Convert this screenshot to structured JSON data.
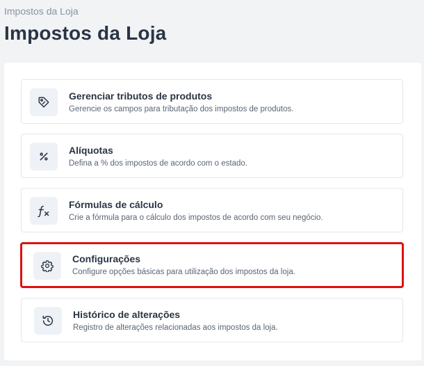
{
  "breadcrumb": "Impostos da Loja",
  "title": "Impostos da Loja",
  "cards": [
    {
      "title": "Gerenciar tributos de produtos",
      "description": "Gerencie os campos para tributação dos impostos de produtos.",
      "icon": "tag-icon"
    },
    {
      "title": "Alíquotas",
      "description": "Defina a % dos impostos de acordo com o estado.",
      "icon": "percent-icon"
    },
    {
      "title": "Fórmulas de cálculo",
      "description": "Crie a fórmula para o cálculo dos impostos de acordo com seu negócio.",
      "icon": "function-icon"
    },
    {
      "title": "Configurações",
      "description": "Configure opções básicas para utilização dos impostos da loja.",
      "icon": "gear-icon",
      "highlighted": true
    },
    {
      "title": "Histórico de alterações",
      "description": "Registro de alterações relacionadas aos impostos da loja.",
      "icon": "history-icon"
    }
  ],
  "colors": {
    "highlight_border": "#e01010",
    "icon_background": "#eef1f5",
    "text_primary": "#2a3444"
  }
}
